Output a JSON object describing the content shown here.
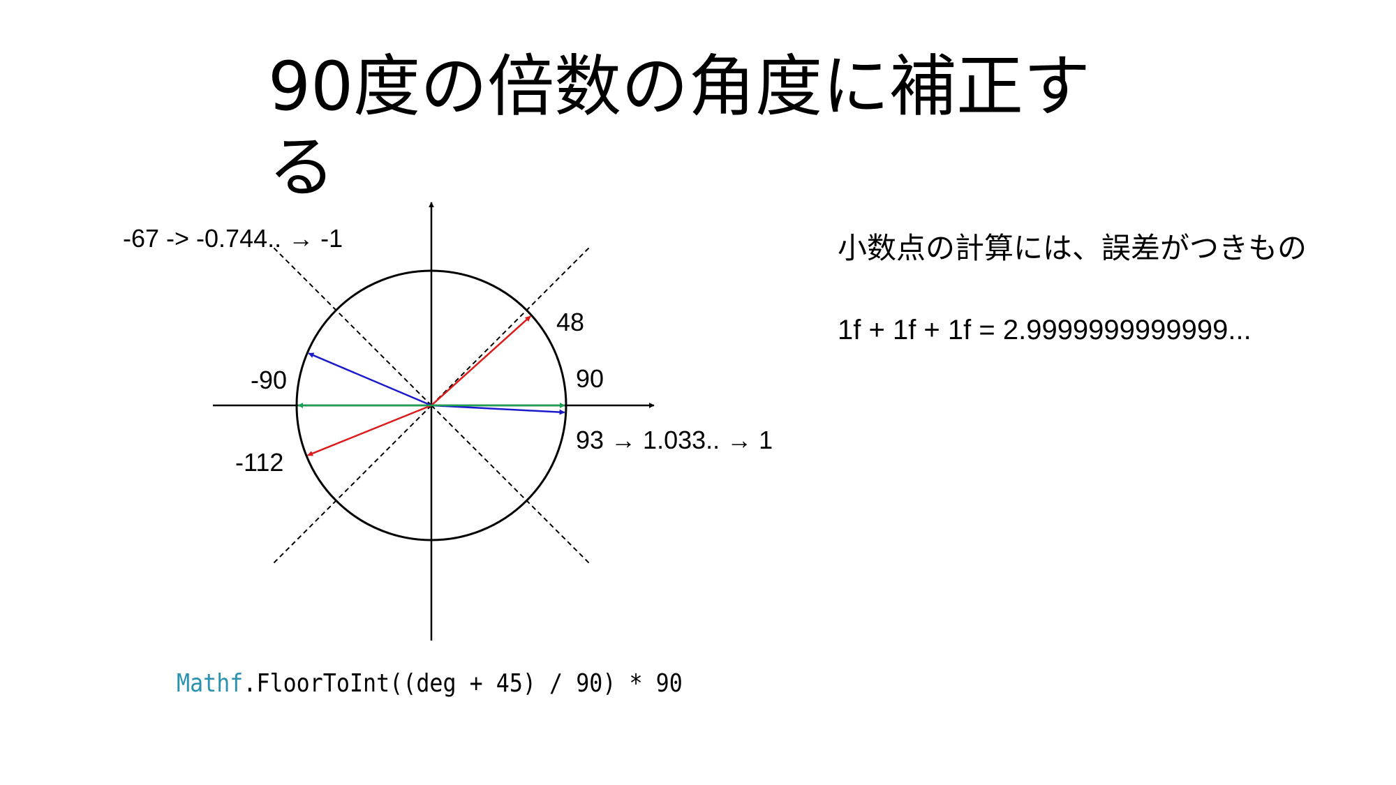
{
  "slide": {
    "title": "90度の倍数の角度に補正する",
    "note": {
      "text": "小数点の計算には、誤差がつきもの",
      "equation": "1f + 1f + 1f = 2.9999999999999..."
    },
    "code": {
      "class_name": "Mathf",
      "rest": ".FloorToInt((deg + 45) / 90) * 90"
    }
  },
  "diagram": {
    "labels": {
      "upper_left": "-67 -> -0.744.. → -1",
      "upper_right": "48",
      "left": "-90",
      "right": "90",
      "lower_right": "93 → 1.033.. →  1",
      "lower_left": "-112"
    },
    "vectors": [
      {
        "deg": -67,
        "color": "#1a1acc"
      },
      {
        "deg": 48,
        "color": "#dd1a1a"
      },
      {
        "deg": 93,
        "color": "#1a1acc"
      },
      {
        "deg": -112,
        "color": "#dd1a1a"
      },
      {
        "deg": 90,
        "color": "#1aa050"
      },
      {
        "deg": -90,
        "color": "#1aa050"
      }
    ],
    "boundaries_deg": [
      45,
      -45,
      135,
      -135
    ]
  }
}
